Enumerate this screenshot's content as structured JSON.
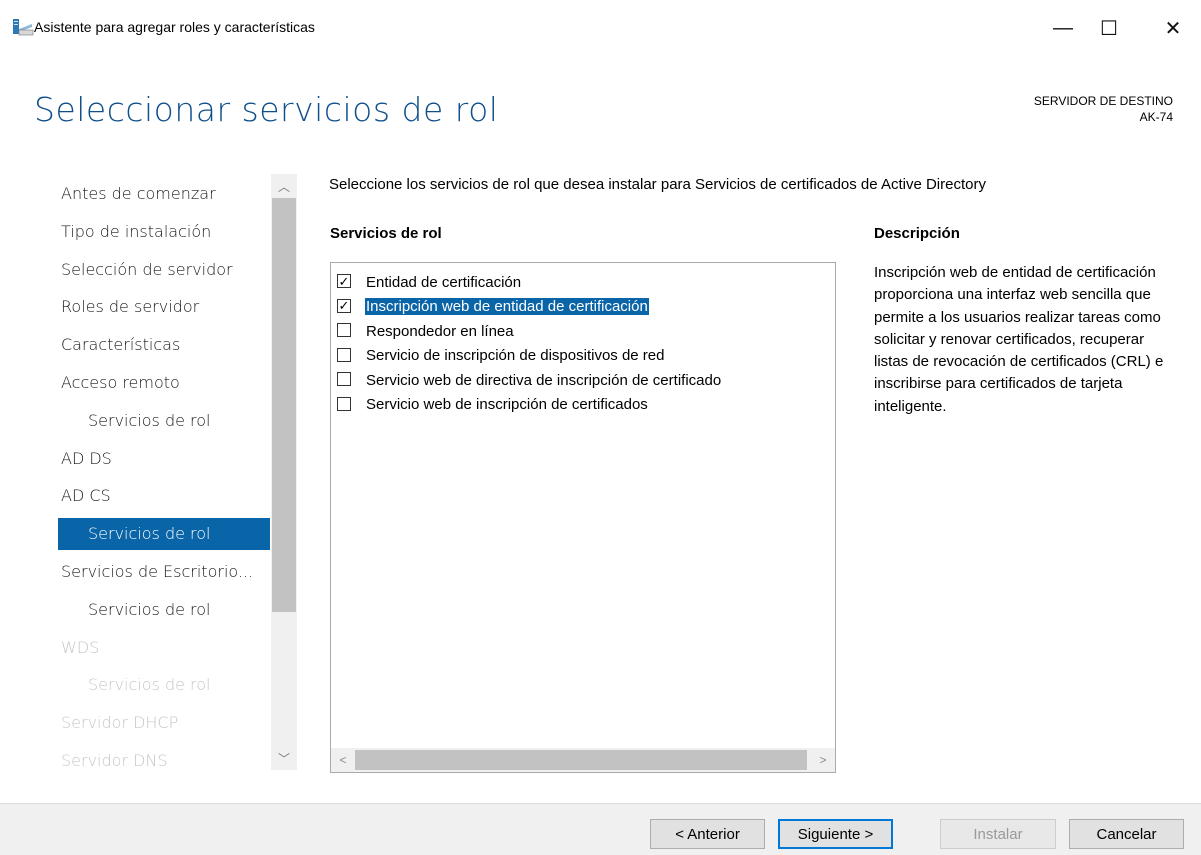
{
  "window": {
    "title": "Asistente para agregar roles y características",
    "minimize_icon": "—",
    "maximize_icon": "☐",
    "close_icon": "✕"
  },
  "header": {
    "page_title": "Seleccionar servicios de rol",
    "destination_label": "SERVIDOR DE DESTINO",
    "destination_server": "AK-74"
  },
  "nav": {
    "items": [
      {
        "label": "Antes de comenzar",
        "level": 0,
        "state": "normal"
      },
      {
        "label": "Tipo de instalación",
        "level": 0,
        "state": "normal"
      },
      {
        "label": "Selección de servidor",
        "level": 0,
        "state": "normal"
      },
      {
        "label": "Roles de servidor",
        "level": 0,
        "state": "normal"
      },
      {
        "label": "Características",
        "level": 0,
        "state": "normal"
      },
      {
        "label": "Acceso remoto",
        "level": 0,
        "state": "normal"
      },
      {
        "label": "Servicios de rol",
        "level": 1,
        "state": "normal"
      },
      {
        "label": "AD DS",
        "level": 0,
        "state": "normal"
      },
      {
        "label": "AD CS",
        "level": 0,
        "state": "normal"
      },
      {
        "label": "Servicios de rol",
        "level": 1,
        "state": "active"
      },
      {
        "label": "Servicios de Escritorio...",
        "level": 0,
        "state": "normal"
      },
      {
        "label": "Servicios de rol",
        "level": 1,
        "state": "normal"
      },
      {
        "label": "WDS",
        "level": 0,
        "state": "disabled"
      },
      {
        "label": "Servicios de rol",
        "level": 1,
        "state": "disabled"
      },
      {
        "label": "Servidor DHCP",
        "level": 0,
        "state": "disabled"
      },
      {
        "label": "Servidor DNS",
        "level": 0,
        "state": "disabled"
      }
    ]
  },
  "content": {
    "instructions": "Seleccione los servicios de rol que desea instalar para Servicios de certificados de Active Directory",
    "list_heading": "Servicios de rol",
    "description_heading": "Descripción",
    "role_services": [
      {
        "label": "Entidad de certificación",
        "checked": true,
        "selected": false
      },
      {
        "label": "Inscripción web de entidad de certificación",
        "checked": true,
        "selected": true
      },
      {
        "label": "Respondedor en línea",
        "checked": false,
        "selected": false
      },
      {
        "label": "Servicio de inscripción de dispositivos de red",
        "checked": false,
        "selected": false
      },
      {
        "label": "Servicio web de directiva de inscripción de certificado",
        "checked": false,
        "selected": false
      },
      {
        "label": "Servicio web de inscripción de certificados",
        "checked": false,
        "selected": false
      }
    ],
    "description": "Inscripción web de entidad de certificación proporciona una interfaz web sencilla que permite a los usuarios realizar tareas como solicitar y renovar certificados, recuperar listas de revocación de certificados (CRL) e inscribirse para certificados de tarjeta inteligente."
  },
  "footer": {
    "previous_label": "< Anterior",
    "next_label": "Siguiente >",
    "install_label": "Instalar",
    "cancel_label": "Cancelar"
  },
  "colors": {
    "accent": "#0a64a8",
    "title_blue": "#0f4f8a"
  }
}
